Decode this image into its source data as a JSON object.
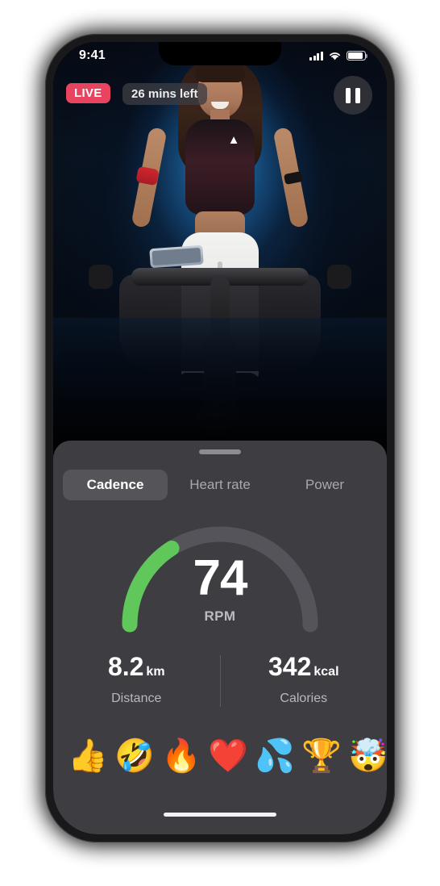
{
  "status_bar": {
    "time": "9:41",
    "signal_icon": "cellular-signal-icon",
    "wifi_icon": "wifi-icon",
    "battery_icon": "battery-icon"
  },
  "video": {
    "live_badge": "LIVE",
    "time_remaining": "26 mins left",
    "pause_icon": "pause-icon",
    "scene_description": "Live cycling instructor on spin bike"
  },
  "sheet": {
    "grabber": "drag-handle",
    "tabs": [
      {
        "label": "Cadence",
        "active": true
      },
      {
        "label": "Heart rate",
        "active": false
      },
      {
        "label": "Power",
        "active": false
      }
    ],
    "gauge": {
      "value": "74",
      "unit": "RPM",
      "percent": 32,
      "arc_color": "#60c85a",
      "track_color": "#55545a"
    },
    "stats": [
      {
        "value": "8.2",
        "unit": "km",
        "label": "Distance"
      },
      {
        "value": "342",
        "unit": "kcal",
        "label": "Calories"
      }
    ],
    "reactions": [
      {
        "glyph": "👍",
        "name": "thumbs-up"
      },
      {
        "glyph": "🤣",
        "name": "rolling-on-floor-laughing"
      },
      {
        "glyph": "🔥",
        "name": "fire"
      },
      {
        "glyph": "❤️",
        "name": "red-heart"
      },
      {
        "glyph": "💦",
        "name": "sweat-droplets"
      },
      {
        "glyph": "🏆",
        "name": "trophy"
      },
      {
        "glyph": "🤯",
        "name": "exploding-head"
      }
    ]
  },
  "colors": {
    "live": "#e8445f",
    "panel": "#3e3d42",
    "active_tab": "#555459",
    "accent_green": "#60c85a"
  }
}
